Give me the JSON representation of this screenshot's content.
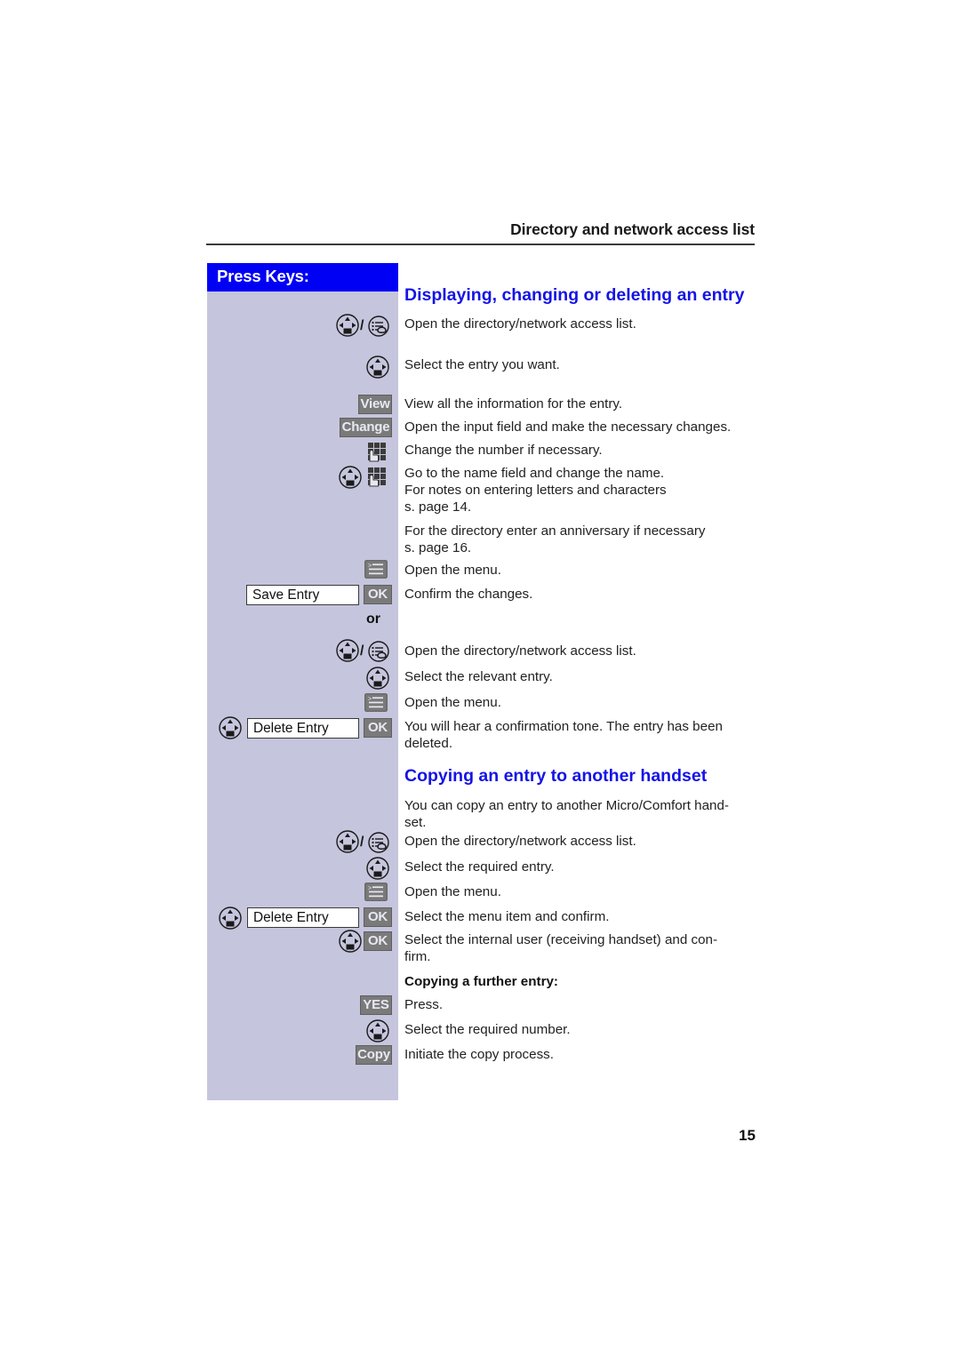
{
  "header": {
    "title": "Directory and network access list"
  },
  "sidebar": {
    "title": "Press Keys:"
  },
  "sections": [
    {
      "title": "Displaying, changing or deleting an entry"
    },
    {
      "title": "Copying an entry to another handset"
    }
  ],
  "steps": {
    "open_dir_1": "Open the directory/network access list.",
    "select_entry": "Select the entry you want.",
    "view_all": "View all the information for the entry.",
    "open_input": "Open the input field and make the necessary changes.",
    "change_number": "Change the number if necessary.",
    "goto_name": "Go to the name field and change the name.\nFor notes on entering letters and characters\ns. page 14.",
    "anniversary": "For the directory enter an anniversary if necessary\ns. page 16.",
    "open_menu_1": "Open the menu.",
    "confirm_changes": "Confirm the changes.",
    "open_dir_2": "Open the directory/network access list.",
    "select_relevant": "Select the relevant entry.",
    "open_menu_2": "Open the menu.",
    "deleted_tone": "You will hear a confirmation tone. The entry has been\ndeleted.",
    "copy_intro": "You can copy an entry to another Micro/Comfort hand-\nset.",
    "open_dir_3": "Open the directory/network access list.",
    "select_required_entry": "Select the required entry.",
    "open_menu_3": "Open the menu.",
    "select_menu_item": "Select the menu item and confirm.",
    "select_internal_user": "Select the internal user (receiving handset) and con-\nfirm.",
    "copying_further": "Copying a further entry:",
    "press": "Press.",
    "select_required_number": "Select the required number.",
    "initiate_copy": "Initiate the copy process."
  },
  "keys": {
    "view": "View",
    "change": "Change",
    "ok": "OK",
    "yes": "YES",
    "copy": "Copy",
    "or": "or",
    "save_entry": "Save Entry",
    "delete_entry_1": "Delete Entry",
    "delete_entry_2": "Delete Entry"
  },
  "footer": {
    "page_number": "15"
  },
  "colors": {
    "accent_blue": "#1414e6",
    "title_bar_blue": "#0000f5",
    "sidebar_bg": "#c5c5dd",
    "softkey_grey": "#7a7a7a"
  }
}
